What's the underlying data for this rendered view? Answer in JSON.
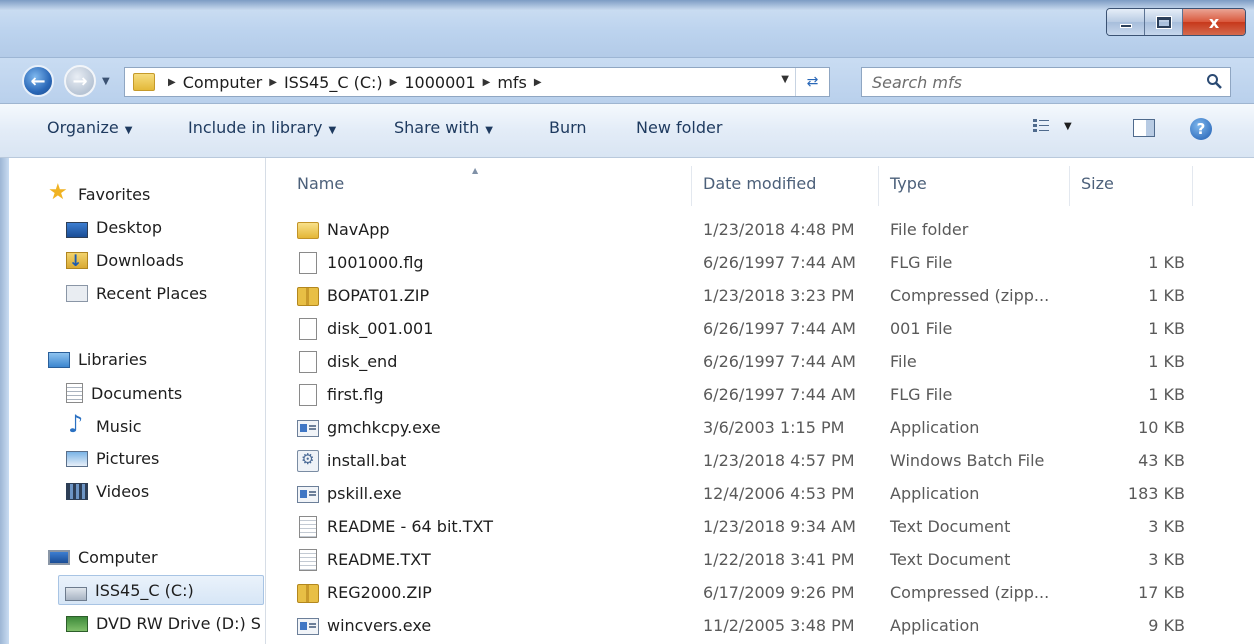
{
  "window": {
    "close_glyph": "x"
  },
  "address_bar": {
    "breadcrumbs": [
      "Computer",
      "ISS45_C (C:)",
      "1000001",
      "mfs"
    ]
  },
  "search": {
    "placeholder": "Search mfs"
  },
  "toolbar": {
    "organize": "Organize",
    "include_in_library": "Include in library",
    "share_with": "Share with",
    "burn": "Burn",
    "new_folder": "New folder"
  },
  "navigation": {
    "favorites": {
      "label": "Favorites",
      "items": [
        "Desktop",
        "Downloads",
        "Recent Places"
      ]
    },
    "libraries": {
      "label": "Libraries",
      "items": [
        "Documents",
        "Music",
        "Pictures",
        "Videos"
      ]
    },
    "computer": {
      "label": "Computer",
      "items": [
        "ISS45_C (C:)",
        "DVD RW Drive (D:) S"
      ]
    }
  },
  "columns": {
    "name": "Name",
    "date_modified": "Date modified",
    "type": "Type",
    "size": "Size"
  },
  "files": [
    {
      "name": "NavApp",
      "date": "1/23/2018 4:48 PM",
      "type": "File folder",
      "size": "",
      "icon": "folder-icon"
    },
    {
      "name": "1001000.flg",
      "date": "6/26/1997 7:44 AM",
      "type": "FLG File",
      "size": "1 KB",
      "icon": "file-icon"
    },
    {
      "name": "BOPAT01.ZIP",
      "date": "1/23/2018 3:23 PM",
      "type": "Compressed (zipp...",
      "size": "1 KB",
      "icon": "zip-folder-icon"
    },
    {
      "name": "disk_001.001",
      "date": "6/26/1997 7:44 AM",
      "type": "001 File",
      "size": "1 KB",
      "icon": "file-icon"
    },
    {
      "name": "disk_end",
      "date": "6/26/1997 7:44 AM",
      "type": "File",
      "size": "1 KB",
      "icon": "file-icon"
    },
    {
      "name": "first.flg",
      "date": "6/26/1997 7:44 AM",
      "type": "FLG File",
      "size": "1 KB",
      "icon": "file-icon"
    },
    {
      "name": "gmchkcpy.exe",
      "date": "3/6/2003 1:15 PM",
      "type": "Application",
      "size": "10 KB",
      "icon": "application-icon"
    },
    {
      "name": "install.bat",
      "date": "1/23/2018 4:57 PM",
      "type": "Windows Batch File",
      "size": "43 KB",
      "icon": "batch-file-icon"
    },
    {
      "name": "pskill.exe",
      "date": "12/4/2006 4:53 PM",
      "type": "Application",
      "size": "183 KB",
      "icon": "application-icon"
    },
    {
      "name": "README - 64 bit.TXT",
      "date": "1/23/2018 9:34 AM",
      "type": "Text Document",
      "size": "3 KB",
      "icon": "text-document-icon"
    },
    {
      "name": "README.TXT",
      "date": "1/22/2018 3:41 PM",
      "type": "Text Document",
      "size": "3 KB",
      "icon": "text-document-icon"
    },
    {
      "name": "REG2000.ZIP",
      "date": "6/17/2009 9:26 PM",
      "type": "Compressed (zipp...",
      "size": "17 KB",
      "icon": "zip-folder-icon"
    },
    {
      "name": "wincvers.exe",
      "date": "11/2/2005 3:48 PM",
      "type": "Application",
      "size": "9 KB",
      "icon": "application-icon"
    }
  ]
}
